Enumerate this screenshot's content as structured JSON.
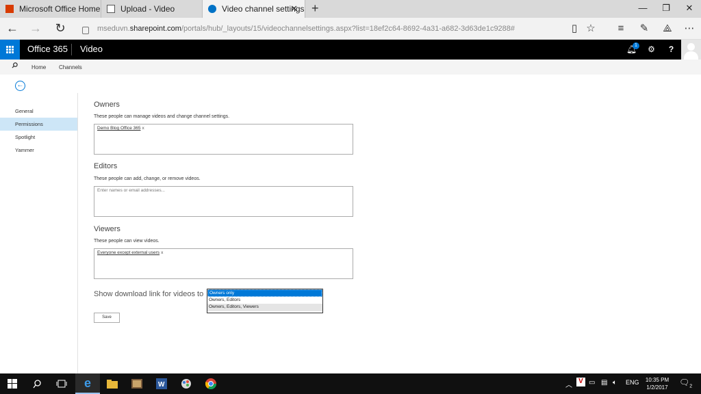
{
  "browser": {
    "tabs": [
      {
        "title": "Microsoft Office Home",
        "icon": "office-icon"
      },
      {
        "title": "Upload - Video",
        "icon": "page-icon"
      },
      {
        "title": "Video channel settings",
        "icon": "sharepoint-icon",
        "active": true
      }
    ],
    "url_prefix": "mseduvn.",
    "url_domain": "sharepoint.com",
    "url_path": "/portals/hub/_layouts/15/videochannelsettings.aspx?list=18ef2c64-8692-4a31-a682-3d63de1c9288#"
  },
  "suite": {
    "brand": "Office 365",
    "app": "Video",
    "notification_count": "1",
    "accent": "#0078d7"
  },
  "subnav": {
    "home": "Home",
    "channels": "Channels"
  },
  "leftnav": {
    "items": [
      "General",
      "Permissions",
      "Spotlight",
      "Yammer"
    ],
    "selected": "Permissions"
  },
  "owners": {
    "heading": "Owners",
    "description": "These people can manage videos and change channel settings.",
    "token": "Demo Blog Office 365"
  },
  "editors": {
    "heading": "Editors",
    "description": "These people can add, change, or remove videos.",
    "placeholder": "Enter names or email addresses..."
  },
  "viewers": {
    "heading": "Viewers",
    "description": "These people can view videos.",
    "token": "Everyone except external users"
  },
  "download": {
    "label": "Show download link for videos to",
    "options": [
      "Owners only",
      "Owners, Editors",
      "Owners, Editors, Viewers"
    ],
    "selected": "Owners only"
  },
  "save_label": "Save",
  "tray": {
    "language": "ENG",
    "time": "10:35 PM",
    "date": "1/2/2017",
    "notifications": "2"
  }
}
